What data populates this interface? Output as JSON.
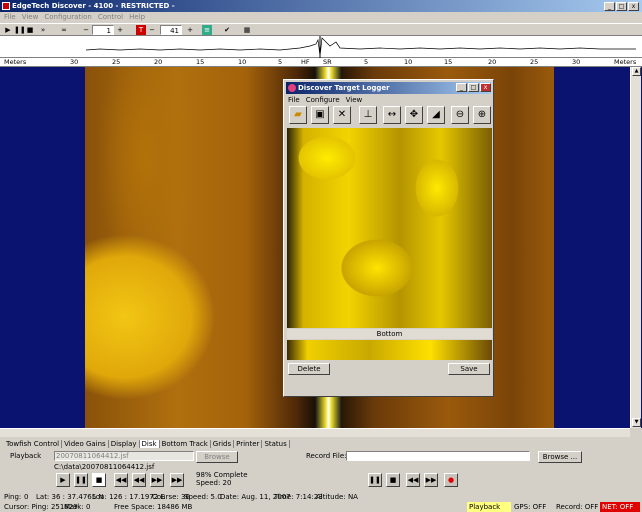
{
  "app": {
    "title": "EdgeTech  Discover - 4100        - RESTRICTED -"
  },
  "menu": [
    "File",
    "View",
    "Configuration",
    "Control",
    "Help"
  ],
  "toolbar": {
    "channel_value": "1",
    "gain_value": "41"
  },
  "scale": {
    "unit_left": "Meters",
    "unit_right": "Meters",
    "left_ticks": [
      "30",
      "25",
      "20",
      "15",
      "10",
      "5"
    ],
    "hf": "HF",
    "sr": "SR",
    "right_ticks": [
      "5",
      "10",
      "15",
      "20",
      "25",
      "30"
    ]
  },
  "target_logger": {
    "title": "Discover Target Logger",
    "menu": [
      "File",
      "Configure",
      "View"
    ],
    "bottom_label": "Bottom",
    "delete_label": "Delete",
    "save_label": "Save"
  },
  "tabs": [
    "Towfish Control",
    "Video Gains",
    "Display",
    "Disk",
    "Bottom Track",
    "Grids",
    "Printer",
    "Status"
  ],
  "disk": {
    "playback_label": "Playback",
    "playback_file": "20070811064412.jsf",
    "browse_label": "Browse",
    "path": "C:\\data\\20070811064412.jsf",
    "record_label": "Record File:",
    "record_browse": "Browse ...",
    "complete": "98% Complete",
    "speed": "Speed: 20"
  },
  "status1": {
    "ping": "Ping:",
    "ping_v": "0",
    "lat": "Lat:  36 : 37.4765 N",
    "lon": "Lon: 126 : 17.1972 E",
    "course": "Course: 36",
    "speed": "Speed:  5.0",
    "date": "Date: Aug. 11, 2007",
    "time": "Time:  7:14:23",
    "alt": "Altitude: NA"
  },
  "status2": {
    "cursor": "Cursor: Ping: 251629",
    "mark": "Mark:",
    "mark_v": "0",
    "free": "Free Space: 18486 MB",
    "playback": "Playback",
    "gps": "GPS: OFF",
    "record": "Record: OFF",
    "net": "NET: OFF"
  },
  "colors": {
    "title_blue": "#0a246a",
    "sonar_bg": "#0a1470",
    "net_red": "#e00000",
    "playback_yellow": "#ffff80"
  }
}
